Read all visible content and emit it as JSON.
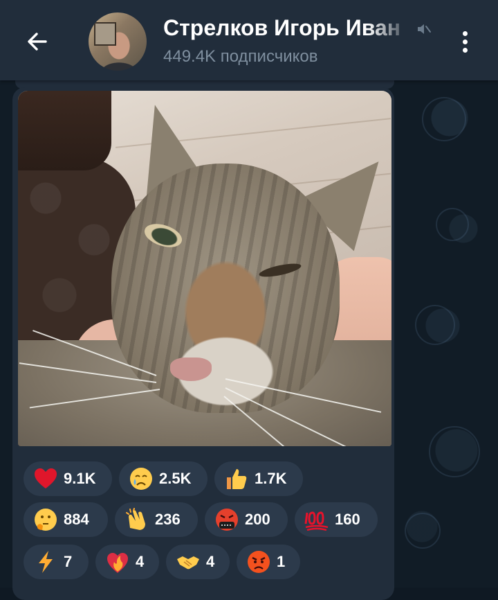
{
  "header": {
    "back_icon": "arrow-left-icon",
    "title": "Стрелков Игорь Иван",
    "muted_icon": "muted-speaker-icon",
    "subtitle": "449.4K подписчиков",
    "menu_icon": "more-vertical-icon"
  },
  "post": {
    "media_description": "photo-cat-closeup"
  },
  "reactions": [
    {
      "icon": "heart-icon",
      "count": "9.1K"
    },
    {
      "icon": "crying-face-icon",
      "count": "2.5K"
    },
    {
      "icon": "thumbs-up-icon",
      "count": "1.7K"
    },
    {
      "icon": "thinking-face-icon",
      "count": "884"
    },
    {
      "icon": "clapping-hands-icon",
      "count": "236"
    },
    {
      "icon": "cursing-face-icon",
      "count": "200"
    },
    {
      "icon": "hundred-points-icon",
      "count": "160"
    },
    {
      "icon": "lightning-icon",
      "count": "7"
    },
    {
      "icon": "heart-on-fire-icon",
      "count": "4"
    },
    {
      "icon": "handshake-icon",
      "count": "4"
    },
    {
      "icon": "angry-face-icon",
      "count": "1"
    }
  ],
  "colors": {
    "header_bg": "#212d3b",
    "chat_bg": "#111c26",
    "pill_bg": "#2c3a4b",
    "subtitle": "#7f8f9f"
  }
}
